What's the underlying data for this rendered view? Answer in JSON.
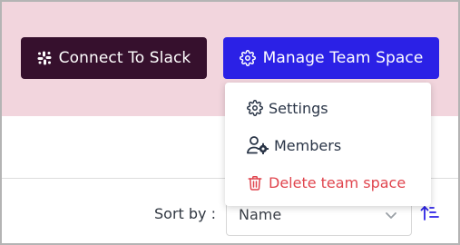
{
  "header": {
    "connect_slack_label": "Connect To Slack",
    "manage_team_space_label": "Manage Team Space"
  },
  "menu": {
    "items": [
      {
        "label": "Settings",
        "icon": "gear-icon"
      },
      {
        "label": "Members",
        "icon": "user-gear-icon"
      },
      {
        "label": "Delete team space",
        "icon": "trash-icon"
      }
    ]
  },
  "sort": {
    "label": "Sort by :",
    "selected": "Name",
    "direction_icon": "sort-ascending-icon"
  },
  "colors": {
    "header_band": "#f2d5dd",
    "slack_button": "#36102d",
    "manage_button": "#2b21e6",
    "danger": "#e0454e",
    "sort_icon": "#2b21e6"
  }
}
